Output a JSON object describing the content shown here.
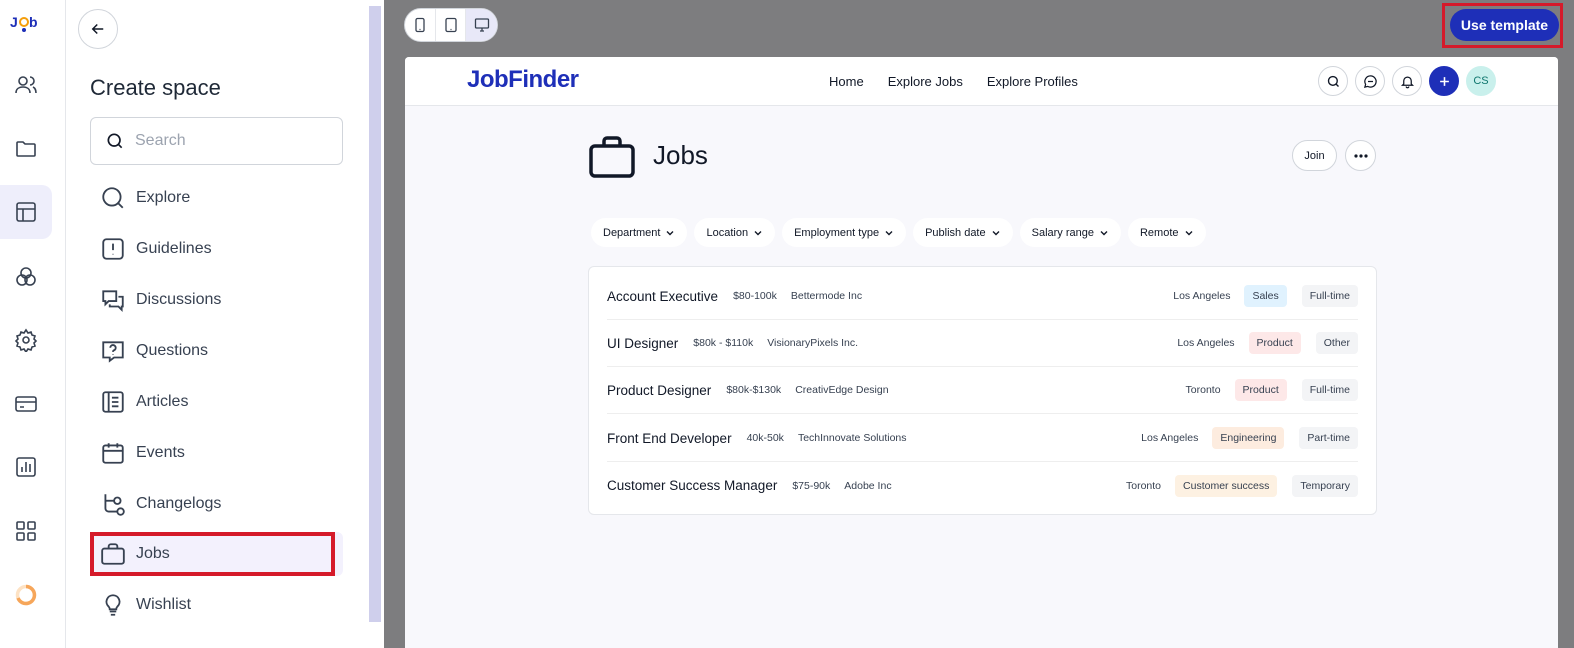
{
  "rail": {
    "logo_text": "Job",
    "items": [
      {
        "icon": "members-icon"
      },
      {
        "icon": "folder-icon"
      },
      {
        "icon": "layout-icon",
        "active": true
      },
      {
        "icon": "circles-icon"
      },
      {
        "icon": "gear-icon"
      },
      {
        "icon": "credit-card-icon"
      },
      {
        "icon": "bar-chart-icon"
      },
      {
        "icon": "apps-grid-icon"
      },
      {
        "icon": "progress-ring-icon"
      }
    ]
  },
  "panel": {
    "title": "Create space",
    "search_placeholder": "Search",
    "items": [
      {
        "label": "Explore",
        "icon": "search-icon"
      },
      {
        "label": "Guidelines",
        "icon": "exclamation-icon"
      },
      {
        "label": "Discussions",
        "icon": "chat-bubbles-icon"
      },
      {
        "label": "Questions",
        "icon": "question-icon"
      },
      {
        "label": "Articles",
        "icon": "article-icon"
      },
      {
        "label": "Events",
        "icon": "calendar-icon"
      },
      {
        "label": "Changelogs",
        "icon": "branch-icon"
      },
      {
        "label": "Jobs",
        "icon": "briefcase-icon",
        "selected": true
      },
      {
        "label": "Wishlist",
        "icon": "lightbulb-icon"
      }
    ]
  },
  "toolbar": {
    "use_template_label": "Use template"
  },
  "site": {
    "logo_text": "JobFinder",
    "nav": [
      "Home",
      "Explore Jobs",
      "Explore Profiles"
    ],
    "avatar_initials": "CS",
    "page_title": "Jobs",
    "join_label": "Join",
    "filters": [
      "Department",
      "Location",
      "Employment type",
      "Publish date",
      "Salary range",
      "Remote"
    ],
    "jobs": [
      {
        "title": "Account Executive",
        "salary": "$80-100k",
        "company": "Bettermode Inc",
        "location": "Los Angeles",
        "department": "Sales",
        "type": "Full-time"
      },
      {
        "title": "UI Designer",
        "salary": "$80k - $110k",
        "company": "VisionaryPixels Inc.",
        "location": "Los Angeles",
        "department": "Product",
        "type": "Other"
      },
      {
        "title": "Product Designer",
        "salary": "$80k-$130k",
        "company": "CreativEdge Design",
        "location": "Toronto",
        "department": "Product",
        "type": "Full-time"
      },
      {
        "title": "Front End Developer",
        "salary": "40k-50k",
        "company": "TechInnovate Solutions",
        "location": "Los Angeles",
        "department": "Engineering",
        "type": "Part-time"
      },
      {
        "title": "Customer Success Manager",
        "salary": "$75-90k",
        "company": "Adobe Inc",
        "location": "Toronto",
        "department": "Customer success",
        "type": "Temporary"
      }
    ]
  },
  "colors": {
    "brand": "#1e2fb8",
    "highlight": "#d51a2a",
    "preview_bg": "#7d7d7f"
  }
}
